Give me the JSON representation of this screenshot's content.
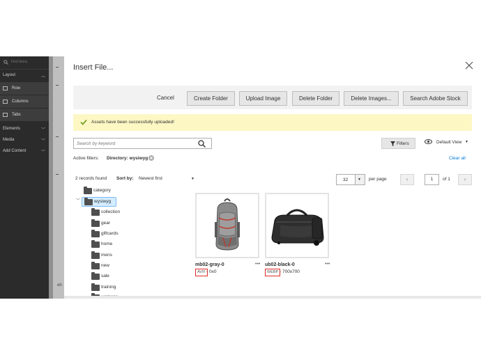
{
  "left_panel": {
    "search_placeholder": "Find Items",
    "sections": [
      {
        "label": "Layout"
      },
      {
        "label": "Elements"
      },
      {
        "label": "Media"
      },
      {
        "label": "Add Content"
      }
    ],
    "layout_items": [
      {
        "label": "Row"
      },
      {
        "label": "Columns"
      },
      {
        "label": "Tabs"
      }
    ]
  },
  "stage": {
    "fragment": "eh"
  },
  "modal": {
    "title": "Insert File...",
    "toolbar": {
      "cancel": "Cancel",
      "create_folder": "Create Folder",
      "upload_image": "Upload Image",
      "delete_folder": "Delete Folder",
      "delete_images": "Delete Images...",
      "search_stock": "Search Adobe Stock"
    },
    "message": "Assets have been successfully uploaded!",
    "search": {
      "placeholder": "Search by keyword"
    },
    "filters_label": "Filters",
    "view_label": "Default View",
    "active_filters": {
      "label": "Active filters:",
      "value": "Directory: wysiwyg",
      "clear_all": "Clear all"
    },
    "records_found": "2 records found",
    "sort_by_label": "Sort by:",
    "sort_value": "Newest first",
    "per_page_value": "32",
    "per_page_label": "per page",
    "page_current": "1",
    "page_of": "of 1",
    "folder_tree": [
      {
        "label": "category"
      },
      {
        "label": "wysiwyg"
      },
      {
        "label": "collection"
      },
      {
        "label": "gear"
      },
      {
        "label": "giftcards"
      },
      {
        "label": "home"
      },
      {
        "label": "mens"
      },
      {
        "label": "new"
      },
      {
        "label": "sale"
      },
      {
        "label": "training"
      },
      {
        "label": "womens"
      }
    ],
    "assets": [
      {
        "name": "mb02-gray-0",
        "type": "AVIF",
        "dimensions": "0x0",
        "image": "gray-backpack"
      },
      {
        "name": "ub02-black-0",
        "type": "WEBP",
        "dimensions": "700x700",
        "image": "black-duffel-bag"
      }
    ]
  },
  "colors": {
    "left_panel_bg": "#2b2b2b",
    "message_bg": "#fdf7c4",
    "success_check": "#79a22e",
    "link": "#007bdb",
    "type_badge_border": "#e02b27",
    "selected_folder_bg": "#d4ecff"
  },
  "icons": {
    "close": "close-icon",
    "check": "check-icon",
    "search": "search-icon",
    "filter": "funnel-icon",
    "view": "eye-icon",
    "folder": "folder-icon",
    "more": "ellipsis-icon"
  }
}
